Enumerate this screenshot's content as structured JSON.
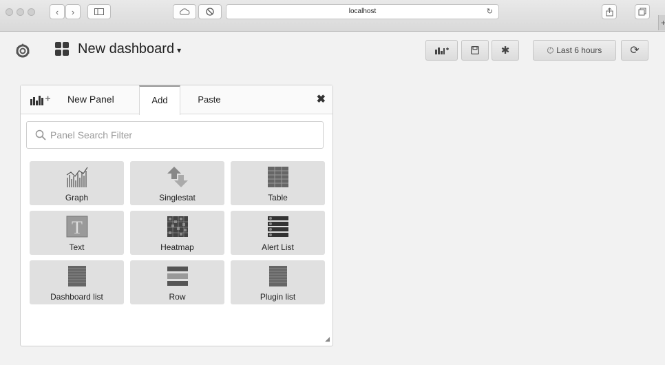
{
  "browser": {
    "url": "localhost"
  },
  "nav": {
    "dashboard_title": "New dashboard",
    "caret": "▾",
    "time_range": "Last 6 hours"
  },
  "panel": {
    "title": "New Panel",
    "tabs": [
      {
        "label": "Add",
        "active": true
      },
      {
        "label": "Paste",
        "active": false
      }
    ],
    "close": "✖",
    "search_placeholder": "Panel Search Filter",
    "items": [
      {
        "label": "Graph",
        "icon": "graph-icon"
      },
      {
        "label": "Singlestat",
        "icon": "singlestat-icon"
      },
      {
        "label": "Table",
        "icon": "table-icon"
      },
      {
        "label": "Text",
        "icon": "text-icon"
      },
      {
        "label": "Heatmap",
        "icon": "heatmap-icon"
      },
      {
        "label": "Alert List",
        "icon": "alert-list-icon"
      },
      {
        "label": "Dashboard list",
        "icon": "dashboard-list-icon"
      },
      {
        "label": "Row",
        "icon": "row-icon"
      },
      {
        "label": "Plugin list",
        "icon": "plugin-list-icon"
      }
    ]
  }
}
